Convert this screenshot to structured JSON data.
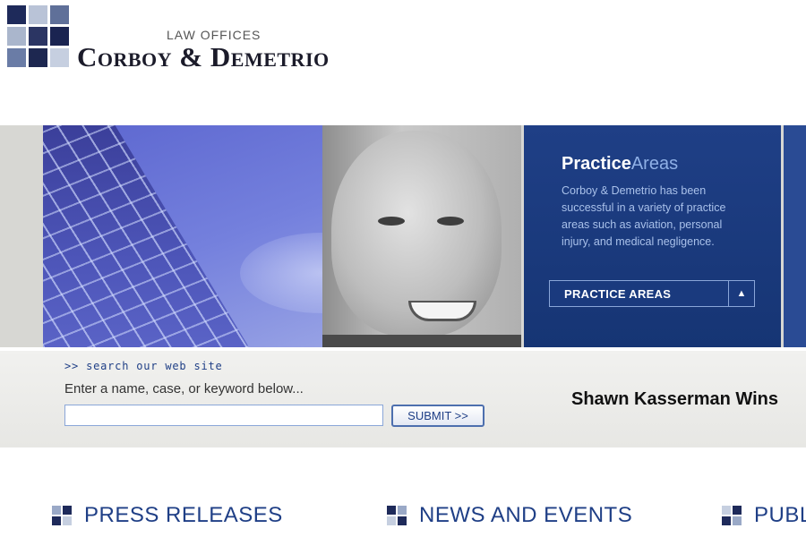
{
  "header": {
    "small_title": "LAW OFFICES",
    "firm_name": "Corboy & Demetrio",
    "logo_colors": [
      "#1e2a5a",
      "#b9c3d7",
      "#5f7099",
      "#aab6cc",
      "#2b3563",
      "#1a2451",
      "#6a7ca6",
      "#1d2750",
      "#c6cfe0"
    ]
  },
  "banner": {
    "practice_title_bold": "Practice",
    "practice_title_light": "Areas",
    "practice_description": "Corboy & Demetrio has been successful in a variety of practice areas such as aviation, personal injury, and medical negligence.",
    "practice_button_label": "PRACTICE AREAS",
    "practice_button_icon": "triangle-up-icon"
  },
  "search": {
    "link_text": ">> search our web site",
    "prompt": "Enter a name, case, or keyword below...",
    "input_value": "",
    "submit_label": "SUBMIT >>"
  },
  "news_headline": "Shawn Kasserman Wins",
  "nav": {
    "items": [
      {
        "label": "PRESS RELEASES",
        "icon": "grid-icon"
      },
      {
        "label": "NEWS AND EVENTS",
        "icon": "grid-icon"
      },
      {
        "label": "PUBL",
        "icon": "grid-icon"
      }
    ]
  },
  "colors": {
    "brand_navy": "#1f3f86",
    "panel_text": "#a9c1ea"
  }
}
